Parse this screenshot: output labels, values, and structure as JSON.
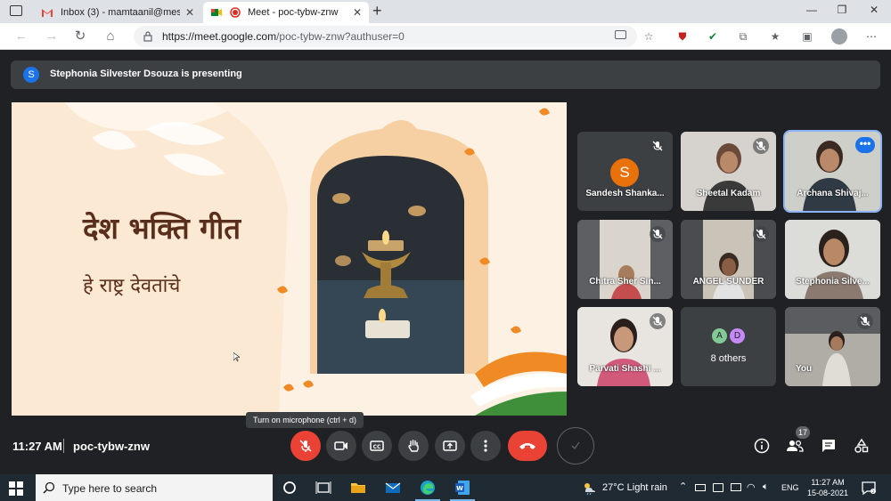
{
  "browser": {
    "tabs": [
      {
        "label": "Inbox (3) - mamtaanil@mes.ac.in",
        "active": false,
        "icon": "gmail-icon"
      },
      {
        "label": "Meet - poc-tybw-znw",
        "active": true,
        "icon": "meet-icon"
      }
    ],
    "new_tab": "+",
    "url_host": "https://meet.google.com",
    "url_path": "/poc-tybw-znw?authuser=0"
  },
  "meet": {
    "presenting_avatar": "S",
    "presenting_text": "Stephonia Silvester Dsouza is presenting",
    "slide": {
      "title": "देश भक्ति गीत",
      "subtitle": "हे राष्ट्र देवतांचे"
    },
    "participants": [
      {
        "name": "Sandesh Shanka...",
        "avatar": "S",
        "muted": true,
        "video": false
      },
      {
        "name": "Sheetal Kadam",
        "muted": true,
        "video": true
      },
      {
        "name": "Archana Shivaj...",
        "muted": false,
        "video": true,
        "active": true
      },
      {
        "name": "Chitra Sher Sin...",
        "muted": true,
        "video": true
      },
      {
        "name": "ANGEL SUNDER",
        "muted": true,
        "video": true
      },
      {
        "name": "Stephonia Silve...",
        "muted": false,
        "video": true
      },
      {
        "name": "Parvati Shashi ...",
        "muted": true,
        "video": true
      },
      {
        "name": "8 others",
        "avatars": [
          "A",
          "D"
        ]
      },
      {
        "name": "You",
        "muted": true,
        "video": true
      }
    ],
    "tooltip": "Turn on microphone (ctrl + d)",
    "time": "11:27 AM",
    "meeting_code": "poc-tybw-znw",
    "people_count": "17"
  },
  "taskbar": {
    "search_placeholder": "Type here to search",
    "weather": "27°C  Light rain",
    "lang": "ENG",
    "time": "11:27 AM",
    "date": "15-08-2021"
  },
  "colors": {
    "meet_bg": "#202124",
    "tile_bg": "#3c4043",
    "end_call": "#ea4335",
    "accent": "#1a73e8",
    "slide_bg": "#fbe9d3",
    "saffron": "#f08a24",
    "green": "#3f8f3a"
  }
}
